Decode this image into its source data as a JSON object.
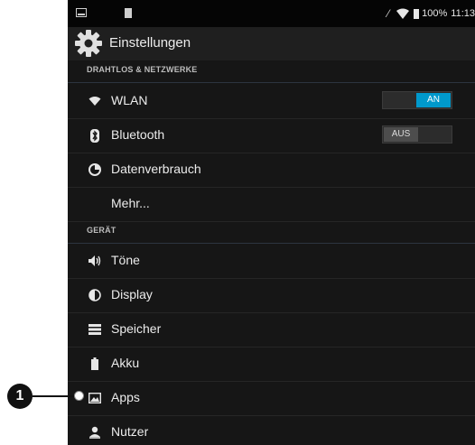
{
  "status_bar": {
    "battery": "100%",
    "time": "11:13"
  },
  "action_bar": {
    "title": "Einstellungen",
    "icon": "gear-icon"
  },
  "sections": [
    {
      "header": "DRAHTLOS & NETZWERKE"
    },
    {
      "header": "GERÄT"
    }
  ],
  "rows": {
    "wlan": {
      "label": "WLAN",
      "icon": "wifi-icon",
      "toggle": "AN",
      "toggle_on": true
    },
    "bluetooth": {
      "label": "Bluetooth",
      "icon": "bluetooth-icon",
      "toggle": "AUS",
      "toggle_on": false
    },
    "data_usage": {
      "label": "Datenverbrauch",
      "icon": "data-usage-icon"
    },
    "more": {
      "label": "Mehr..."
    },
    "sound": {
      "label": "Töne",
      "icon": "speaker-icon"
    },
    "display": {
      "label": "Display",
      "icon": "brightness-icon"
    },
    "storage": {
      "label": "Speicher",
      "icon": "storage-icon"
    },
    "battery": {
      "label": "Akku",
      "icon": "battery-icon"
    },
    "apps": {
      "label": "Apps",
      "icon": "apps-icon"
    },
    "users": {
      "label": "Nutzer",
      "icon": "user-icon"
    }
  },
  "callout": {
    "number": "1"
  },
  "colors": {
    "background": "#161616",
    "accent": "#0099cc",
    "text": "#ececec"
  }
}
